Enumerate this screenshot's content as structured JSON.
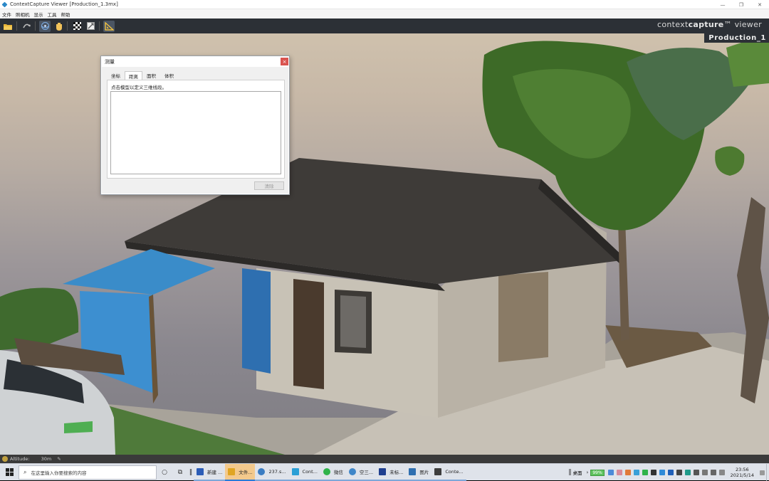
{
  "window": {
    "title": "ContextCapture Viewer [Production_1.3mx]",
    "controls": [
      "—",
      "❐",
      "✕"
    ]
  },
  "menu": [
    "文件",
    "照相机",
    "显示",
    "工具",
    "帮助"
  ],
  "toolbar": {
    "buttons": [
      "open-folder",
      "orbit",
      "navigate-sphere",
      "pan-hand",
      "checker-grid",
      "zoom-extent",
      "measure"
    ],
    "brand_pre": "context",
    "brand_bold": "capture",
    "brand_post": "™ viewer"
  },
  "viewport": {
    "production_label": "Production_1"
  },
  "measure_dialog": {
    "title": "测量",
    "close": "×",
    "tabs": [
      "坐标",
      "距离",
      "面积",
      "体积"
    ],
    "selected_tab": "距离",
    "instruction": "点击模型以定义三维线段。",
    "clear_button": "清除"
  },
  "status": {
    "label": "Altitude:",
    "value": "30m",
    "pen": "✎"
  },
  "taskbar": {
    "search_placeholder": "在这里输入你要搜索的内容",
    "tasks": [
      {
        "label": "新建 ...",
        "color": "#2b5cb6",
        "state": "open"
      },
      {
        "label": "文件...",
        "color": "#e0a522",
        "state": "active"
      },
      {
        "label": "237.s...",
        "color": "#3a7cc2",
        "state": "open"
      },
      {
        "label": "Cont...",
        "color": "#2a9fd6",
        "state": "open"
      },
      {
        "label": "微信",
        "color": "#2fb34a",
        "state": "open"
      },
      {
        "label": "空三...",
        "color": "#3f86c8",
        "state": "open"
      },
      {
        "label": "未标...",
        "color": "#1f3f8f",
        "state": "open"
      },
      {
        "label": "图片",
        "color": "#2f6fb0",
        "state": "open"
      },
      {
        "label": "Conte...",
        "color": "#3d3d3d",
        "state": "open"
      }
    ],
    "desktop_label": "桌面",
    "battery": "99%",
    "time": "23:56",
    "date": "2021/5/14"
  }
}
